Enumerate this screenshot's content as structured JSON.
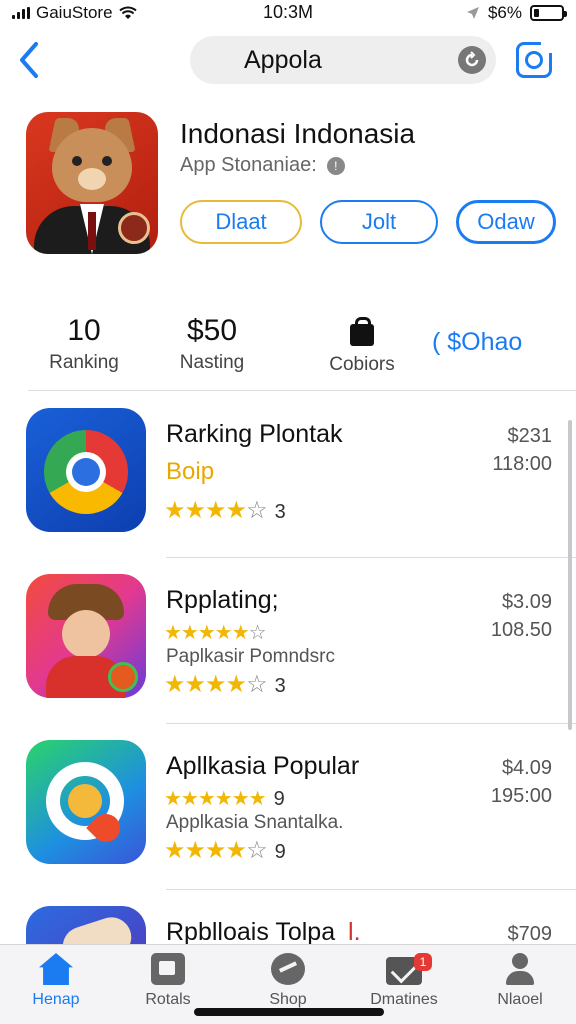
{
  "status_bar": {
    "carrier": "GaiuStore",
    "time": "10:3M",
    "battery_text": "$6%",
    "battery_level": 0.2
  },
  "nav": {
    "search_text": "Appola",
    "back_icon": "chevron-left-icon",
    "refresh_icon": "refresh-icon",
    "share_icon": "share-icon"
  },
  "featured_app": {
    "title": "Indonasi Indonasia",
    "subtitle": "App Stonaniae:",
    "info_icon": "info-icon",
    "buttons": [
      "Dlaat",
      "Jolt",
      "Odaw"
    ]
  },
  "stats": [
    {
      "value": "10",
      "label": "Ranking"
    },
    {
      "value": "$50",
      "label": "Nasting"
    },
    {
      "value": "",
      "label": "Cobiors",
      "icon": "bag-icon"
    },
    {
      "value": "( $Ohao",
      "label": ""
    }
  ],
  "apps": [
    {
      "title": "Rarking Plontak",
      "tag": "Boip",
      "tag_color": "#e8a800",
      "price_top": "$231",
      "price_bottom": "118:00",
      "rating": 4,
      "rating_count": "3"
    },
    {
      "title": "Rpplating;",
      "subtitle": "Paplkasir Pomndsrc",
      "price_top": "$3.09",
      "price_bottom": "108.50",
      "rating_small": 5,
      "rating": 4,
      "rating_count": "3"
    },
    {
      "title": "Apllkasia Popular",
      "subtitle": "Applkasia Snantalka.",
      "price_top": "$4.09",
      "price_bottom": "195:00",
      "rating_small": 6,
      "rating_small_count": "9",
      "rating": 4,
      "rating_count": "9"
    },
    {
      "title": "Rpblloais Tolpa",
      "title_mark": "l.",
      "price_top": "$709",
      "price_bottom": ""
    }
  ],
  "tabs": [
    {
      "label": "Henap",
      "icon": "home-icon",
      "active": true
    },
    {
      "label": "Rotals",
      "icon": "photo-icon",
      "active": false
    },
    {
      "label": "Shop",
      "icon": "chat-icon",
      "active": false
    },
    {
      "label": "Dmatines",
      "icon": "mail-icon",
      "badge": "1",
      "active": false
    },
    {
      "label": "Nlaoel",
      "icon": "person-icon",
      "active": false
    }
  ],
  "colors": {
    "accent": "#1a7cf0",
    "star": "#f2b705",
    "badge": "#e53935"
  }
}
